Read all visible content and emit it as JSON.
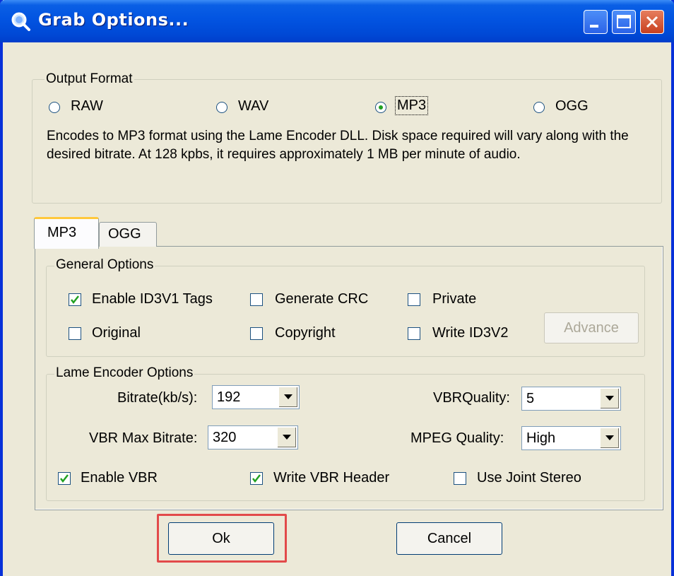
{
  "window": {
    "title": "Grab Options..."
  },
  "output_format": {
    "label": "Output Format",
    "options": [
      {
        "label": "RAW",
        "selected": false
      },
      {
        "label": "WAV",
        "selected": false
      },
      {
        "label": "MP3",
        "selected": true
      },
      {
        "label": "OGG",
        "selected": false
      }
    ],
    "description": "Encodes to MP3 format using the Lame Encoder DLL.  Disk space required will vary along with the desired bitrate.  At 128 kpbs, it requires approximately 1 MB per minute of audio."
  },
  "tabs": [
    {
      "label": "MP3",
      "active": true
    },
    {
      "label": "OGG",
      "active": false
    }
  ],
  "general_options": {
    "label": "General Options",
    "checkboxes": [
      {
        "label": "Enable ID3V1 Tags",
        "checked": true
      },
      {
        "label": "Generate CRC",
        "checked": false
      },
      {
        "label": "Private",
        "checked": false
      },
      {
        "label": "Original",
        "checked": false
      },
      {
        "label": "Copyright",
        "checked": false
      },
      {
        "label": "Write ID3V2",
        "checked": false
      }
    ],
    "advance_button": "Advance"
  },
  "lame_options": {
    "label": "Lame Encoder Options",
    "bitrate": {
      "label": "Bitrate(kb/s):",
      "value": "192"
    },
    "vbr_max_bitrate": {
      "label": "VBR Max Bitrate:",
      "value": "320"
    },
    "vbr_quality": {
      "label": "VBRQuality:",
      "value": "5"
    },
    "mpeg_quality": {
      "label": "MPEG Quality:",
      "value": "High"
    },
    "checkboxes": [
      {
        "label": "Enable VBR",
        "checked": true
      },
      {
        "label": "Write VBR Header",
        "checked": true
      },
      {
        "label": "Use Joint Stereo",
        "checked": false
      }
    ]
  },
  "buttons": {
    "ok": "Ok",
    "cancel": "Cancel"
  },
  "colors": {
    "titlebar": "#0054e3",
    "window_face": "#ece9d8",
    "highlight": "#e24a4a",
    "radio_dot": "#21a121"
  }
}
